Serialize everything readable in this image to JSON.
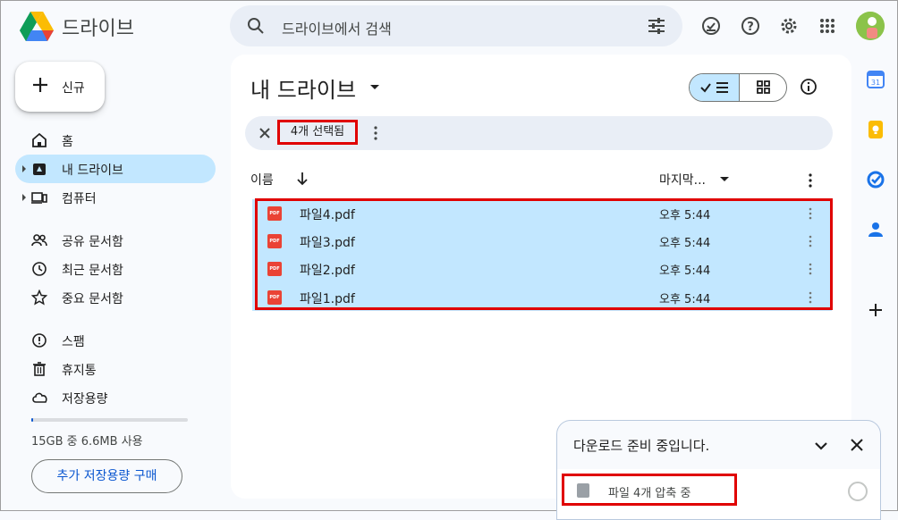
{
  "header": {
    "app_title": "드라이브",
    "search_placeholder": "드라이브에서 검색"
  },
  "sidebar": {
    "new_label": "신규",
    "items": [
      {
        "label": "홈"
      },
      {
        "label": "내 드라이브"
      },
      {
        "label": "컴퓨터"
      },
      {
        "label": "공유 문서함"
      },
      {
        "label": "최근 문서함"
      },
      {
        "label": "중요 문서함"
      },
      {
        "label": "스팸"
      },
      {
        "label": "휴지통"
      },
      {
        "label": "저장용량"
      }
    ],
    "storage_text": "15GB 중 6.6MB 사용",
    "storage_fraction": 0.0004,
    "buy_label": "추가 저장용량 구매"
  },
  "main": {
    "title": "내 드라이브",
    "selection_count": "4개 선택됨",
    "columns": {
      "name": "이름",
      "modified": "마지막..."
    },
    "files": [
      {
        "name": "파일4.pdf",
        "modified": "오후 5:44",
        "type": "PDF"
      },
      {
        "name": "파일3.pdf",
        "modified": "오후 5:44",
        "type": "PDF"
      },
      {
        "name": "파일2.pdf",
        "modified": "오후 5:44",
        "type": "PDF"
      },
      {
        "name": "파일1.pdf",
        "modified": "오후 5:44",
        "type": "PDF"
      }
    ]
  },
  "toast": {
    "title": "다운로드 준비 중입니다.",
    "item_label": "파일 4개 압축 중"
  },
  "colors": {
    "accent": "#0b57d0",
    "selection": "#c2e7ff",
    "highlight_border": "#e00000"
  }
}
